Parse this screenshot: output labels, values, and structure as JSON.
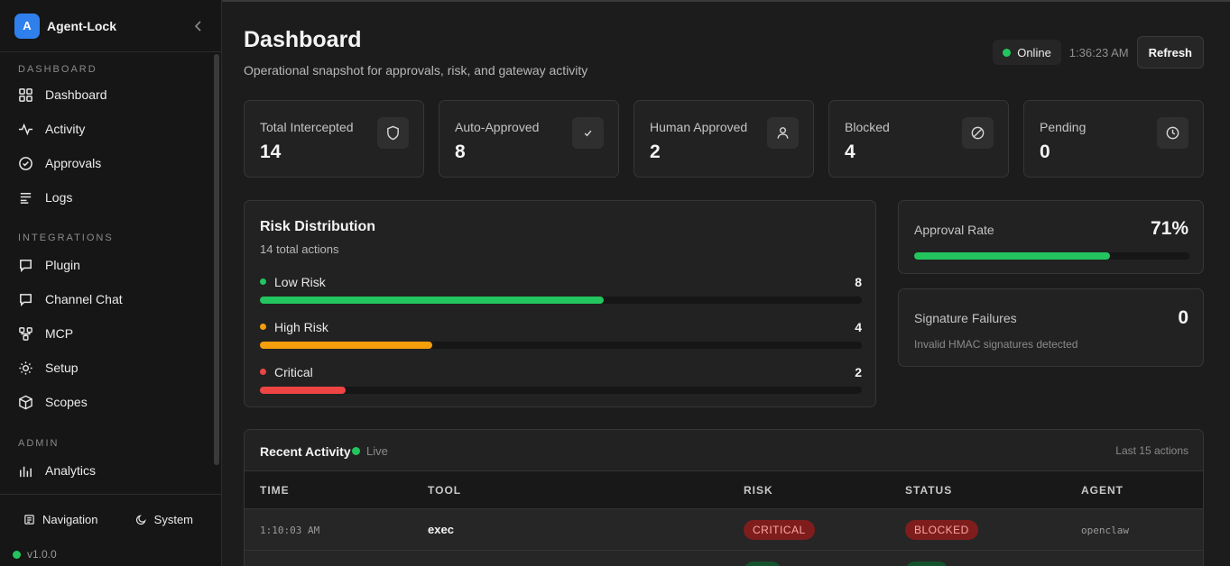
{
  "app": {
    "logo_letter": "A",
    "name": "Agent-Lock",
    "version": "v1.0.0"
  },
  "sidebar": {
    "sections": [
      {
        "label": "DASHBOARD",
        "items": [
          {
            "label": "Dashboard",
            "icon": "grid-icon"
          },
          {
            "label": "Activity",
            "icon": "pulse-icon"
          },
          {
            "label": "Approvals",
            "icon": "check-circle-icon"
          },
          {
            "label": "Logs",
            "icon": "lines-icon"
          }
        ]
      },
      {
        "label": "INTEGRATIONS",
        "items": [
          {
            "label": "Plugin",
            "icon": "message-icon"
          },
          {
            "label": "Channel Chat",
            "icon": "chat-icon"
          },
          {
            "label": "MCP",
            "icon": "network-icon"
          },
          {
            "label": "Setup",
            "icon": "sun-icon"
          },
          {
            "label": "Scopes",
            "icon": "cube-icon"
          }
        ]
      },
      {
        "label": "ADMIN",
        "items": [
          {
            "label": "Analytics",
            "icon": "bar-chart-icon"
          }
        ]
      }
    ],
    "footer": {
      "navigation_label": "Navigation",
      "system_label": "System"
    }
  },
  "header": {
    "title": "Dashboard",
    "subtitle": "Operational snapshot for approvals, risk, and gateway activity",
    "status": "Online",
    "time": "1:36:23 AM",
    "refresh_label": "Refresh"
  },
  "stats": [
    {
      "label": "Total Intercepted",
      "value": "14",
      "icon": "shield-icon"
    },
    {
      "label": "Auto-Approved",
      "value": "8",
      "icon": "check-icon"
    },
    {
      "label": "Human Approved",
      "value": "2",
      "icon": "user-icon"
    },
    {
      "label": "Blocked",
      "value": "4",
      "icon": "ban-icon"
    },
    {
      "label": "Pending",
      "value": "0",
      "icon": "clock-icon"
    }
  ],
  "risk": {
    "title": "Risk Distribution",
    "subtitle": "14 total actions",
    "total": 14,
    "rows": [
      {
        "label": "Low Risk",
        "count": 8,
        "fraction": 0.5714,
        "color": "#22c55e"
      },
      {
        "label": "High Risk",
        "count": 4,
        "fraction": 0.2857,
        "color": "#f59e0b"
      },
      {
        "label": "Critical",
        "count": 2,
        "fraction": 0.1429,
        "color": "#ef4444"
      }
    ]
  },
  "approval_rate": {
    "label": "Approval Rate",
    "value": "71%",
    "fraction": 0.71,
    "color": "#22c55e"
  },
  "signature_failures": {
    "label": "Signature Failures",
    "value": "0",
    "subtitle": "Invalid HMAC signatures detected"
  },
  "recent_activity": {
    "title": "Recent Activity",
    "live_label": "Live",
    "meta": "Last 15 actions",
    "columns": [
      "TIME",
      "TOOL",
      "RISK",
      "STATUS",
      "AGENT"
    ],
    "rows": [
      {
        "time": "1:10:03 AM",
        "tool": "exec",
        "risk": "CRITICAL",
        "status": "BLOCKED",
        "agent": "openclaw"
      },
      {
        "time": "",
        "tool": "",
        "risk": "",
        "status": "",
        "agent": ""
      }
    ]
  }
}
